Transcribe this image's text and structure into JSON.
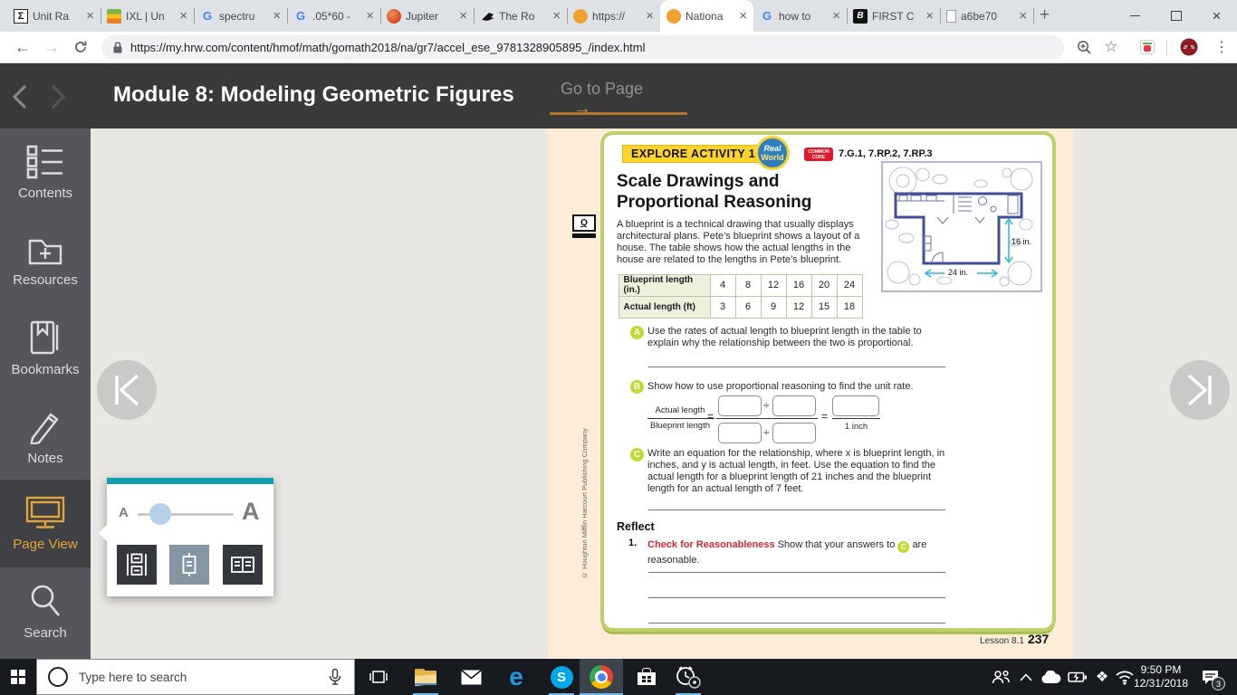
{
  "colors": {
    "accent_orange": "#e2a43c",
    "popup_teal": "#129fae",
    "banner_yellow": "#fcd42c",
    "badge_red": "#e0192d",
    "part_lime": "#c3d830",
    "blueprint_blue": "#3f4f96",
    "dimension_cyan": "#29b6d8",
    "taskbar_underline": "#6cb8f0"
  },
  "browser": {
    "tabs": [
      {
        "title": "Unit Ra"
      },
      {
        "title": "IXL | Un"
      },
      {
        "title": "spectru"
      },
      {
        "title": ".05*60 -"
      },
      {
        "title": "Jupiter"
      },
      {
        "title": "The Ro"
      },
      {
        "title": "https://"
      },
      {
        "title": "Nationa"
      },
      {
        "title": "how to"
      },
      {
        "title": "FIRST C"
      },
      {
        "title": "a6be70"
      }
    ],
    "url": "https://my.hrw.com/content/hmof/math/gomath2018/na/gr7/accel_ese_9781328905895_/index.html"
  },
  "module_header": {
    "title": "Module 8: Modeling Geometric Figures",
    "go_to_page": "Go to Page"
  },
  "sidebar": {
    "items": [
      {
        "label": "Contents"
      },
      {
        "label": "Resources"
      },
      {
        "label": "Bookmarks"
      },
      {
        "label": "Notes"
      },
      {
        "label": "Page View"
      },
      {
        "label": "Search"
      }
    ]
  },
  "popup": {
    "small_a": "A",
    "large_a": "A"
  },
  "lesson": {
    "activity_banner": "EXPLORE ACTIVITY 1",
    "real_world_line1": "Real",
    "real_world_line2": "World",
    "common_core_line1": "COMMON",
    "common_core_line2": "CORE",
    "standards": "7.G.1, 7.RP.2, 7.RP.3",
    "title_line1": "Scale Drawings and",
    "title_line2": "Proportional Reasoning",
    "q_badge": "Q",
    "intro": "A blueprint is a technical drawing that usually displays architectural plans. Pete’s blueprint shows a layout of a house. The table shows how the actual lengths in the house are related to the lengths in Pete’s blueprint.",
    "table": {
      "rows": [
        {
          "header": "Blueprint length (in.)",
          "values": [
            "4",
            "8",
            "12",
            "16",
            "20",
            "24"
          ]
        },
        {
          "header": "Actual length (ft)",
          "values": [
            "3",
            "6",
            "9",
            "12",
            "15",
            "18"
          ]
        }
      ]
    },
    "blueprint": {
      "height_label": "16 in.",
      "width_label": "24 in."
    },
    "part_a": {
      "letter": "A",
      "text": "Use the rates of actual length to blueprint length in the table to explain why the relationship between the two is proportional."
    },
    "part_b": {
      "letter": "B",
      "text": "Show how to use proportional reasoning to find the unit rate.",
      "fraction_top": "Actual length",
      "fraction_bottom": "Blueprint length",
      "equals_sign": "=",
      "divide_sign": "÷",
      "unit_label": "1 inch"
    },
    "part_c": {
      "letter": "C",
      "text": "Write an equation for the relationship, where x is blueprint length, in inches, and y is actual length, in feet. Use the equation to find the actual length for a blueprint length of 21 inches and the blueprint length for an actual length of 7 feet."
    },
    "reflect": {
      "heading": "Reflect",
      "number": "1.",
      "bold_red": "Check for Reasonableness",
      "text_before": "Show that your answers to",
      "inline_letter": "C",
      "text_after": "are reasonable."
    },
    "footer": {
      "lesson_label": "Lesson 8.1",
      "page_number": "237"
    },
    "copyright": "© Houghton Mifflin Harcourt Publishing Company"
  },
  "taskbar": {
    "search_placeholder": "Type here to search",
    "time": "9:50 PM",
    "date": "12/31/2018",
    "notification_count": "3"
  }
}
